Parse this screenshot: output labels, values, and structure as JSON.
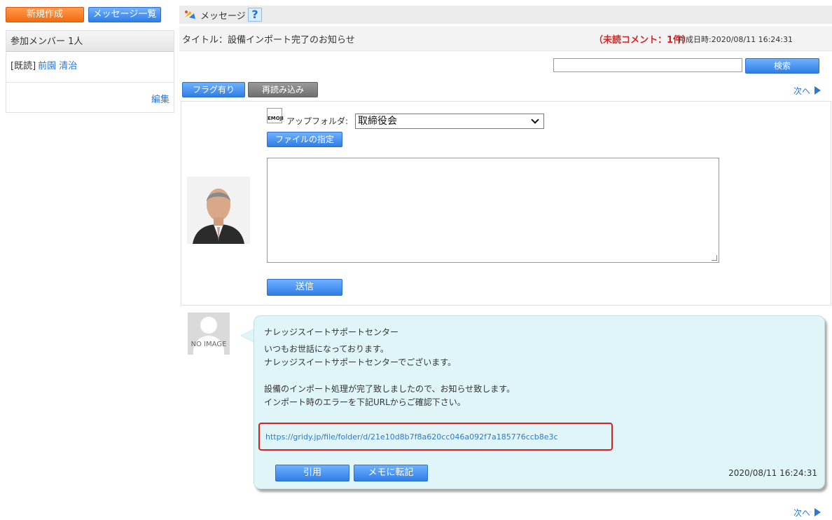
{
  "left": {
    "new_label": "新規作成",
    "list_label": "メッセージ一覧",
    "members_header": "参加メンバー 1人",
    "member": {
      "status": "[既読]",
      "name": "前園 清治"
    },
    "edit_label": "編集"
  },
  "header": {
    "title": "メッセージ",
    "help": "?",
    "subject": "タイトル：設備インポート完了のお知らせ",
    "unread": "（未読コメント：1件）",
    "created": "作成日時:2020/08/11 16:24:31"
  },
  "search": {
    "value": "",
    "button": "検索"
  },
  "toolbar": {
    "flag": "フラグ有り",
    "reload": "再読み込み",
    "next": "次へ"
  },
  "compose": {
    "emoji_label": "EMOJI",
    "upload_folder_label": "アップフォルダ:",
    "folder_value": "取締役会",
    "file_button": "ファイルの指定",
    "send_button": "送信"
  },
  "message": {
    "noimage_label": "NO IMAGE",
    "sender": "ナレッジスイートサポートセンター",
    "body": "いつもお世話になっております。\nナレッジスイートサポートセンターでございます。\n\n設備のインポート処理が完了致しましたので、お知らせ致します。\nインポート時のエラーを下記URLからご確認下さい。",
    "url": "https://gridy.jp/file/folder/d/21e10d8b7f8a620cc046a092f7a185776ccb8e3c",
    "quote_button": "引用",
    "memo_button": "メモに転記",
    "timestamp": "2020/08/11 16:24:31"
  },
  "footer": {
    "next": "次へ"
  },
  "colors": {
    "accent_blue": "#2f7de6",
    "accent_orange": "#f26b10",
    "unread_red": "#e02020",
    "bubble_bg": "#dff5f8"
  }
}
